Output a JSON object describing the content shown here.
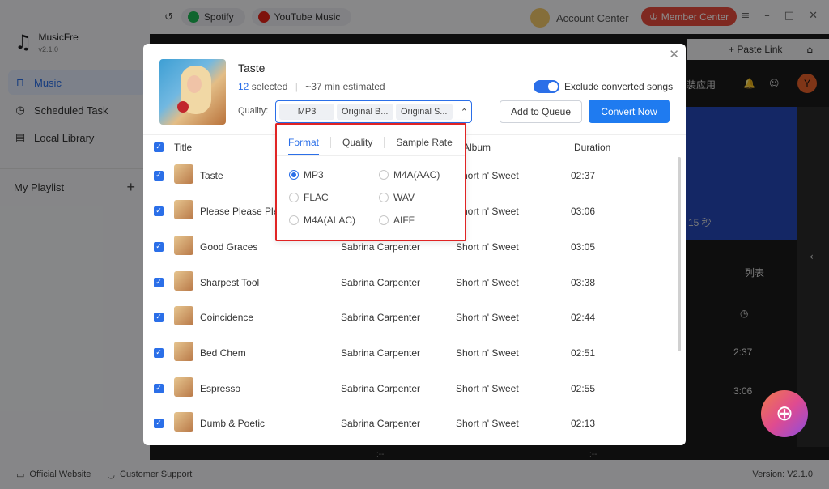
{
  "app": {
    "name": "MusicFre",
    "version": "v2.1.0"
  },
  "sidebar": {
    "items": [
      {
        "label": "Music",
        "icon": "headphones-icon"
      },
      {
        "label": "Scheduled Task",
        "icon": "clock-icon"
      },
      {
        "label": "Local Library",
        "icon": "library-icon"
      }
    ],
    "playlist_label": "My Playlist",
    "add_icon": "+"
  },
  "topbar": {
    "sources": [
      "Spotify",
      "YouTube Music"
    ],
    "account": "Account Center",
    "member": "Member Center"
  },
  "web": {
    "paste_link": "+ Paste Link",
    "apps_text": "装应用",
    "avatar": "Y",
    "sec_text": "15 秒",
    "list_text": "列表",
    "t1": "2:37",
    "t2": "3:06",
    "mini_time_a": ":--",
    "mini_time_b": ":--"
  },
  "modal": {
    "title": "Taste",
    "selected_count": "12",
    "selected_suffix": " selected",
    "estimate": "~37 min estimated",
    "quality_label": "Quality:",
    "quality_chips": [
      "MP3",
      "Original B...",
      "Original S..."
    ],
    "exclude_label": "Exclude converted songs",
    "add_queue": "Add to Queue",
    "convert_now": "Convert Now",
    "columns": [
      "Title",
      "Album",
      "Duration"
    ],
    "rows": [
      {
        "title": "Taste",
        "artist": "",
        "album": "Short n' Sweet",
        "duration": "02:37"
      },
      {
        "title": "Please Please Ple",
        "artist": "",
        "album": "Short n' Sweet",
        "duration": "03:06"
      },
      {
        "title": "Good Graces",
        "artist": "Sabrina Carpenter",
        "album": "Short n' Sweet",
        "duration": "03:05"
      },
      {
        "title": "Sharpest Tool",
        "artist": "Sabrina Carpenter",
        "album": "Short n' Sweet",
        "duration": "03:38"
      },
      {
        "title": "Coincidence",
        "artist": "Sabrina Carpenter",
        "album": "Short n' Sweet",
        "duration": "02:44"
      },
      {
        "title": "Bed Chem",
        "artist": "Sabrina Carpenter",
        "album": "Short n' Sweet",
        "duration": "02:51"
      },
      {
        "title": "Espresso",
        "artist": "Sabrina Carpenter",
        "album": "Short n' Sweet",
        "duration": "02:55"
      },
      {
        "title": "Dumb & Poetic",
        "artist": "Sabrina Carpenter",
        "album": "Short n' Sweet",
        "duration": "02:13"
      }
    ]
  },
  "dropdown": {
    "tabs": [
      "Format",
      "Quality",
      "Sample Rate"
    ],
    "active_tab": "Format",
    "options": [
      "MP3",
      "M4A(AAC)",
      "FLAC",
      "WAV",
      "M4A(ALAC)",
      "AIFF"
    ],
    "selected": "MP3"
  },
  "footer": {
    "website": "Official Website",
    "support": "Customer Support",
    "version": "Version: V2.1.0"
  },
  "colors": {
    "accent": "#2b6fe8",
    "member": "#e84b3c",
    "highlight": "#e02424"
  }
}
